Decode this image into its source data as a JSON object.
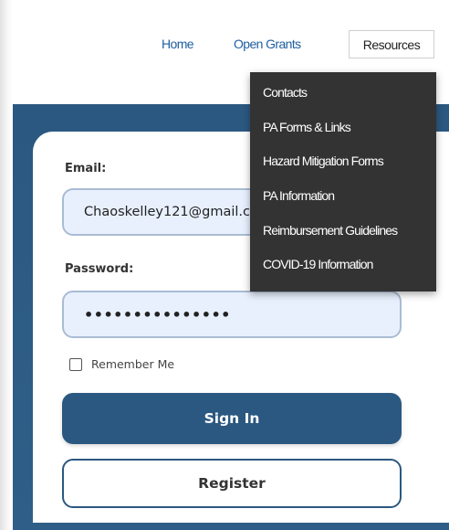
{
  "nav": {
    "home": "Home",
    "open_grants": "Open Grants",
    "resources": "Resources"
  },
  "resources_menu": {
    "items": [
      {
        "label": "Contacts"
      },
      {
        "label": "PA Forms & Links"
      },
      {
        "label": "Hazard Mitigation Forms"
      },
      {
        "label": "PA Information"
      },
      {
        "label": "Reimbursement Guidelines"
      },
      {
        "label": "COVID-19 Information"
      }
    ]
  },
  "login": {
    "email_label": "Email:",
    "email_value": "Chaoskelley121@gmail.com",
    "password_label": "Password:",
    "password_mask": "•••••••••••••••",
    "remember_me": "Remember Me",
    "remember_checked": false,
    "sign_in": "Sign In",
    "register": "Register"
  },
  "colors": {
    "primary": "#2b5880",
    "link": "#1f5fa0",
    "field_bg": "#e8f0fe",
    "menu_bg": "#333333"
  }
}
